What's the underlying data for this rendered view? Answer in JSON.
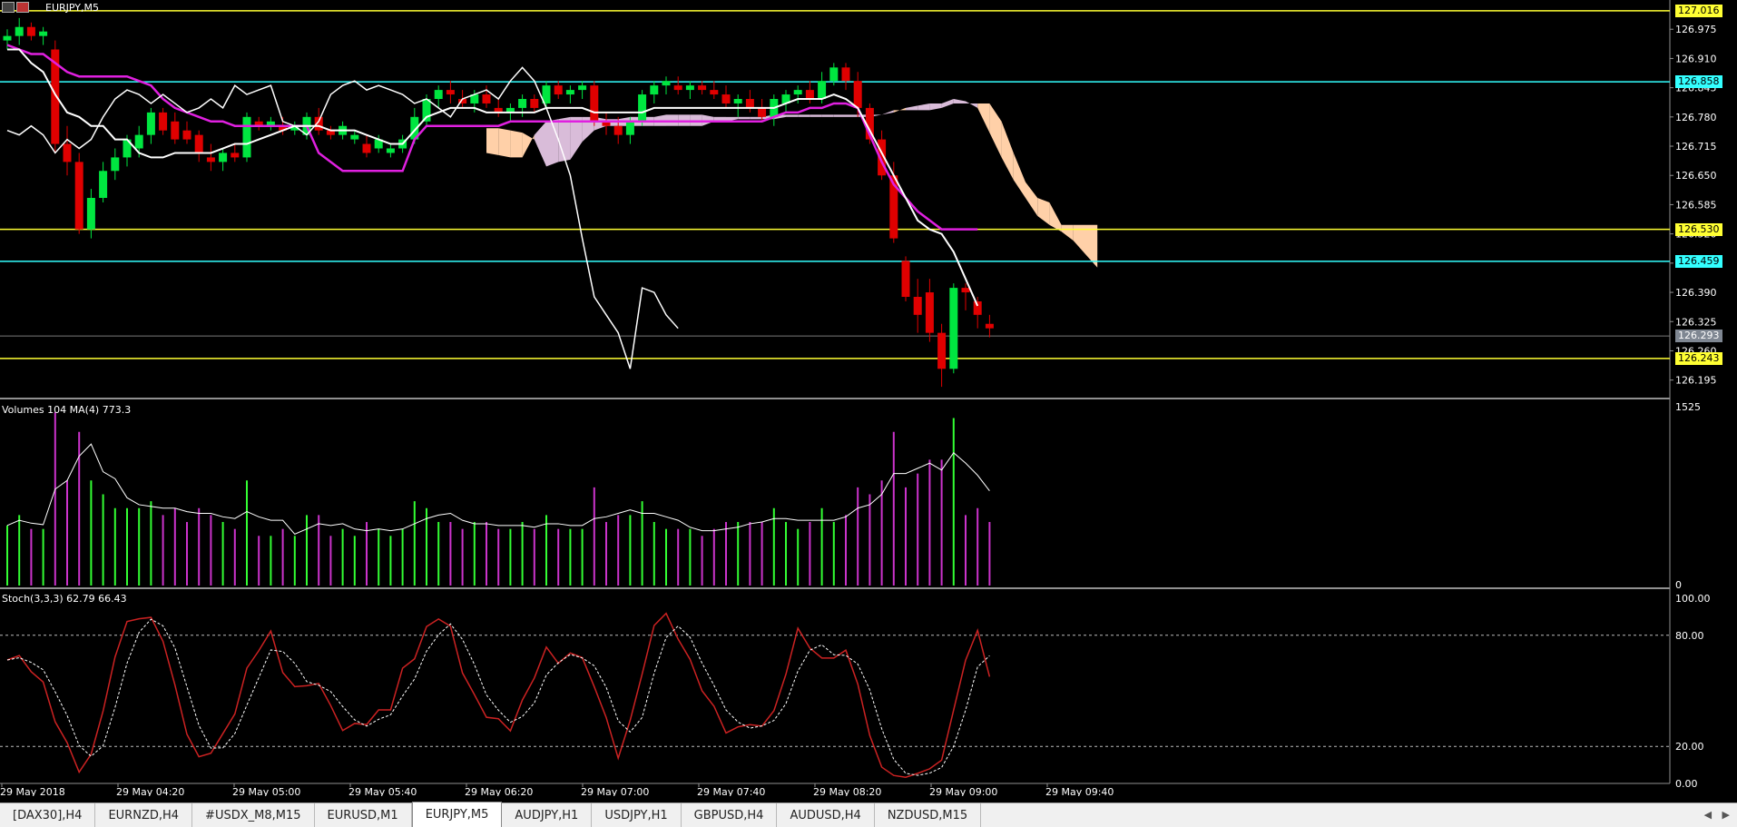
{
  "window": {
    "symbol_title": "EURJPY,M5"
  },
  "colors": {
    "bull": "#00e640",
    "bear": "#e00000",
    "tenkan": "#ffffff",
    "kijun": "#e020e0",
    "chikou": "#ffffff",
    "cloud_up": "#d9bcd9",
    "cloud_down": "#ffd0a8",
    "hline_yellow": "#ffff33",
    "hline_cyan": "#33ffff",
    "vol_up": "#33ff33",
    "vol_down": "#cc33cc",
    "stoch_main": "#cc2222",
    "stoch_signal": "#ffffff",
    "pane_border": "#909090"
  },
  "price_axis": {
    "ticks": [
      "126.975",
      "126.910",
      "126.845",
      "126.780",
      "126.715",
      "126.650",
      "126.585",
      "126.520",
      "126.455",
      "126.390",
      "126.325",
      "126.260",
      "126.195"
    ],
    "ylim": [
      126.158,
      127.04
    ]
  },
  "price_labels": [
    {
      "text": "127.016",
      "price": 127.016,
      "kind": "yellow"
    },
    {
      "text": "126.858",
      "price": 126.858,
      "kind": "cyan"
    },
    {
      "text": "126.530",
      "price": 126.53,
      "kind": "yellow"
    },
    {
      "text": "126.459",
      "price": 126.459,
      "kind": "cyan"
    },
    {
      "text": "126.293",
      "price": 126.293,
      "kind": "current"
    },
    {
      "text": "126.243",
      "price": 126.243,
      "kind": "yellow"
    }
  ],
  "volume_pane": {
    "title": "Volumes 104 MA(4) 773.3",
    "axis_ticks": [
      "1525",
      "0"
    ],
    "ylim": [
      0,
      1525
    ]
  },
  "stoch_pane": {
    "title": "Stoch(3,3,3) 62.79 66.43",
    "axis_ticks": [
      "100.00",
      "80.00",
      "20.00",
      "0.00"
    ],
    "levels": [
      80,
      20
    ]
  },
  "time_axis": {
    "labels": [
      "29 May 2018",
      "29 May 04:20",
      "29 May 05:00",
      "29 May 05:40",
      "29 May 06:20",
      "29 May 07:00",
      "29 May 07:40",
      "29 May 08:20",
      "29 May 09:00",
      "29 May 09:40"
    ]
  },
  "tabs": [
    {
      "label": "[DAX30],H4",
      "active": false
    },
    {
      "label": "EURNZD,H4",
      "active": false
    },
    {
      "label": "#USDX_M8,M15",
      "active": false
    },
    {
      "label": "EURUSD,M1",
      "active": false
    },
    {
      "label": "EURJPY,M5",
      "active": true
    },
    {
      "label": "AUDJPY,H1",
      "active": false
    },
    {
      "label": "USDJPY,H1",
      "active": false
    },
    {
      "label": "GBPUSD,H4",
      "active": false
    },
    {
      "label": "AUDUSD,H4",
      "active": false
    },
    {
      "label": "NZDUSD,M15",
      "active": false
    }
  ],
  "chart_data": {
    "type": "candlestick",
    "symbol": "EURJPY",
    "timeframe": "M5",
    "candles": [
      [
        126.95,
        126.975,
        126.93,
        126.96
      ],
      [
        126.96,
        127.0,
        126.94,
        126.98
      ],
      [
        126.98,
        126.99,
        126.95,
        126.96
      ],
      [
        126.96,
        126.98,
        126.94,
        126.97
      ],
      [
        126.93,
        126.95,
        126.7,
        126.72
      ],
      [
        126.72,
        126.76,
        126.65,
        126.68
      ],
      [
        126.68,
        126.7,
        126.52,
        126.53
      ],
      [
        126.53,
        126.62,
        126.51,
        126.6
      ],
      [
        126.6,
        126.68,
        126.59,
        126.66
      ],
      [
        126.66,
        126.71,
        126.64,
        126.69
      ],
      [
        126.69,
        126.74,
        126.67,
        126.73
      ],
      [
        126.71,
        126.76,
        126.69,
        126.74
      ],
      [
        126.74,
        126.8,
        126.72,
        126.79
      ],
      [
        126.79,
        126.8,
        126.74,
        126.75
      ],
      [
        126.77,
        126.79,
        126.72,
        126.73
      ],
      [
        126.75,
        126.77,
        126.72,
        126.73
      ],
      [
        126.74,
        126.75,
        126.68,
        126.7
      ],
      [
        126.69,
        126.72,
        126.66,
        126.68
      ],
      [
        126.68,
        126.71,
        126.66,
        126.7
      ],
      [
        126.7,
        126.72,
        126.68,
        126.69
      ],
      [
        126.69,
        126.79,
        126.68,
        126.78
      ],
      [
        126.77,
        126.78,
        126.75,
        126.76
      ],
      [
        126.76,
        126.78,
        126.75,
        126.77
      ],
      [
        126.76,
        126.78,
        126.74,
        126.75
      ],
      [
        126.75,
        126.77,
        126.74,
        126.76
      ],
      [
        126.74,
        126.79,
        126.73,
        126.78
      ],
      [
        126.78,
        126.8,
        126.74,
        126.75
      ],
      [
        126.75,
        126.76,
        126.73,
        126.74
      ],
      [
        126.74,
        126.77,
        126.73,
        126.76
      ],
      [
        126.73,
        126.75,
        126.72,
        126.74
      ],
      [
        126.72,
        126.74,
        126.69,
        126.7
      ],
      [
        126.71,
        126.74,
        126.7,
        126.73
      ],
      [
        126.7,
        126.72,
        126.69,
        126.71
      ],
      [
        126.71,
        126.74,
        126.7,
        126.73
      ],
      [
        126.73,
        126.8,
        126.72,
        126.78
      ],
      [
        126.77,
        126.83,
        126.76,
        126.82
      ],
      [
        126.82,
        126.85,
        126.8,
        126.84
      ],
      [
        126.84,
        126.86,
        126.81,
        126.83
      ],
      [
        126.82,
        126.84,
        126.8,
        126.81
      ],
      [
        126.81,
        126.84,
        126.79,
        126.83
      ],
      [
        126.83,
        126.85,
        126.8,
        126.81
      ],
      [
        126.8,
        126.82,
        126.78,
        126.79
      ],
      [
        126.79,
        126.81,
        126.77,
        126.8
      ],
      [
        126.8,
        126.83,
        126.78,
        126.82
      ],
      [
        126.82,
        126.83,
        126.79,
        126.8
      ],
      [
        126.81,
        126.86,
        126.8,
        126.85
      ],
      [
        126.85,
        126.86,
        126.82,
        126.83
      ],
      [
        126.83,
        126.85,
        126.81,
        126.84
      ],
      [
        126.84,
        126.86,
        126.82,
        126.85
      ],
      [
        126.85,
        126.86,
        126.76,
        126.77
      ],
      [
        126.77,
        126.79,
        126.74,
        126.76
      ],
      [
        126.76,
        126.78,
        126.72,
        126.74
      ],
      [
        126.74,
        126.78,
        126.72,
        126.77
      ],
      [
        126.77,
        126.84,
        126.76,
        126.83
      ],
      [
        126.83,
        126.86,
        126.81,
        126.85
      ],
      [
        126.85,
        126.87,
        126.83,
        126.86
      ],
      [
        126.85,
        126.87,
        126.83,
        126.84
      ],
      [
        126.84,
        126.86,
        126.82,
        126.85
      ],
      [
        126.85,
        126.86,
        126.83,
        126.84
      ],
      [
        126.84,
        126.86,
        126.82,
        126.83
      ],
      [
        126.83,
        126.85,
        126.8,
        126.81
      ],
      [
        126.81,
        126.83,
        126.78,
        126.82
      ],
      [
        126.82,
        126.84,
        126.79,
        126.8
      ],
      [
        126.8,
        126.82,
        126.77,
        126.78
      ],
      [
        126.78,
        126.83,
        126.76,
        126.82
      ],
      [
        126.81,
        126.84,
        126.79,
        126.83
      ],
      [
        126.83,
        126.85,
        126.81,
        126.84
      ],
      [
        126.84,
        126.86,
        126.81,
        126.82
      ],
      [
        126.82,
        126.88,
        126.81,
        126.86
      ],
      [
        126.86,
        126.9,
        126.85,
        126.89
      ],
      [
        126.89,
        126.9,
        126.84,
        126.86
      ],
      [
        126.86,
        126.88,
        126.78,
        126.8
      ],
      [
        126.8,
        126.81,
        126.72,
        126.73
      ],
      [
        126.73,
        126.75,
        126.64,
        126.65
      ],
      [
        126.65,
        126.68,
        126.5,
        126.51
      ],
      [
        126.46,
        126.47,
        126.37,
        126.38
      ],
      [
        126.38,
        126.42,
        126.3,
        126.34
      ],
      [
        126.39,
        126.42,
        126.28,
        126.3
      ],
      [
        126.3,
        126.32,
        126.18,
        126.22
      ],
      [
        126.22,
        126.41,
        126.21,
        126.4
      ],
      [
        126.4,
        126.41,
        126.35,
        126.39
      ],
      [
        126.37,
        126.38,
        126.31,
        126.34
      ],
      [
        126.32,
        126.34,
        126.29,
        126.31
      ]
    ],
    "tenkan": [
      126.93,
      126.93,
      126.9,
      126.88,
      126.83,
      126.79,
      126.78,
      126.76,
      126.76,
      126.73,
      126.73,
      126.7,
      126.69,
      126.69,
      126.7,
      126.7,
      126.7,
      126.7,
      126.71,
      126.72,
      126.72,
      126.73,
      126.74,
      126.75,
      126.76,
      126.76,
      126.76,
      126.75,
      126.75,
      126.75,
      126.74,
      126.73,
      126.72,
      126.72,
      126.75,
      126.78,
      126.79,
      126.8,
      126.8,
      126.8,
      126.79,
      126.79,
      126.79,
      126.79,
      126.79,
      126.8,
      126.8,
      126.8,
      126.8,
      126.79,
      126.79,
      126.79,
      126.79,
      126.79,
      126.8,
      126.8,
      126.8,
      126.8,
      126.8,
      126.8,
      126.8,
      126.8,
      126.8,
      126.8,
      126.8,
      126.81,
      126.82,
      126.82,
      126.82,
      126.83,
      126.82,
      126.8,
      126.75,
      126.7,
      126.65,
      126.6,
      126.55,
      126.53,
      126.52,
      126.48,
      126.42,
      126.36
    ],
    "kijun": [
      126.94,
      126.93,
      126.92,
      126.92,
      126.9,
      126.88,
      126.87,
      126.87,
      126.87,
      126.87,
      126.87,
      126.86,
      126.85,
      126.82,
      126.8,
      126.79,
      126.78,
      126.77,
      126.77,
      126.76,
      126.76,
      126.76,
      126.76,
      126.76,
      126.76,
      126.76,
      126.7,
      126.68,
      126.66,
      126.66,
      126.66,
      126.66,
      126.66,
      126.66,
      126.73,
      126.76,
      126.76,
      126.76,
      126.76,
      126.76,
      126.76,
      126.76,
      126.77,
      126.77,
      126.77,
      126.77,
      126.77,
      126.77,
      126.77,
      126.77,
      126.77,
      126.77,
      126.77,
      126.77,
      126.77,
      126.77,
      126.77,
      126.77,
      126.77,
      126.77,
      126.77,
      126.77,
      126.77,
      126.77,
      126.78,
      126.79,
      126.79,
      126.8,
      126.8,
      126.81,
      126.81,
      126.8,
      126.74,
      126.68,
      126.63,
      126.6,
      126.57,
      126.55,
      126.53,
      126.53,
      126.53,
      126.53
    ]
  }
}
